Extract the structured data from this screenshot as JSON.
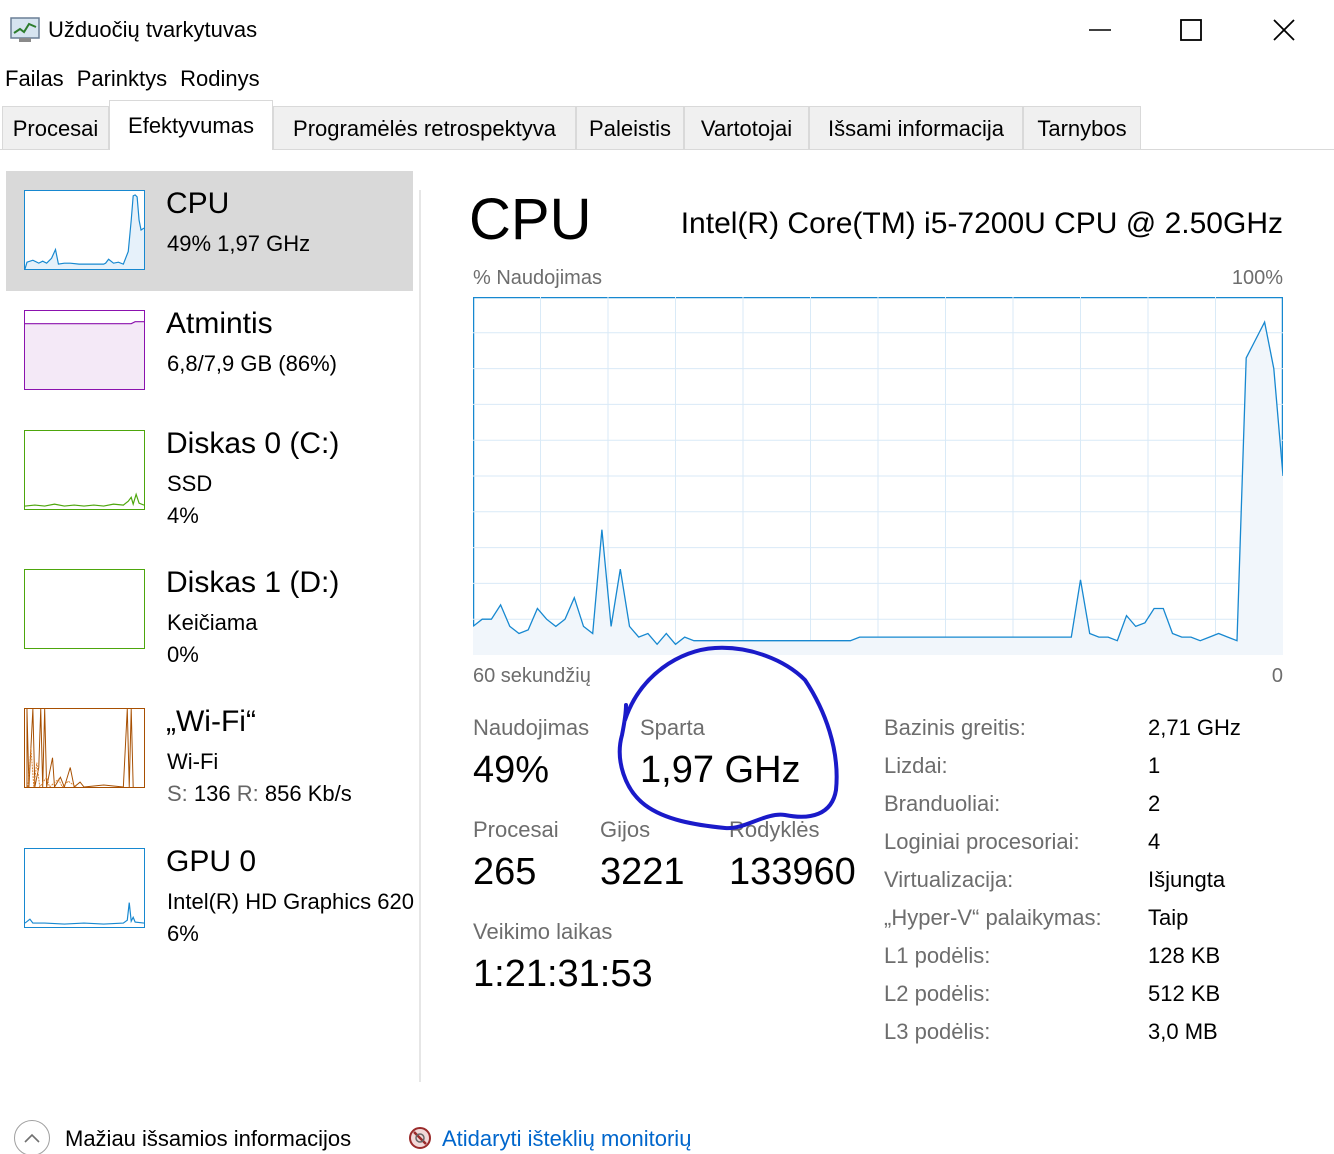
{
  "window": {
    "title": "Užduočių tvarkytuvas",
    "icon": "task-manager-icon"
  },
  "menu": [
    "Failas",
    "Parinktys",
    "Rodinys"
  ],
  "tabs": [
    {
      "label": "Procesai",
      "active": false
    },
    {
      "label": "Efektyvumas",
      "active": true
    },
    {
      "label": "Programėlės retrospektyva",
      "active": false
    },
    {
      "label": "Paleistis",
      "active": false
    },
    {
      "label": "Vartotojai",
      "active": false
    },
    {
      "label": "Išsami informacija",
      "active": false
    },
    {
      "label": "Tarnybos",
      "active": false
    }
  ],
  "devices": [
    {
      "name": "CPU",
      "line1": "49%  1,97 GHz",
      "line2": "",
      "color": "#1788d0"
    },
    {
      "name": "Atmintis",
      "line1": "6,8/7,9 GB (86%)",
      "line2": "",
      "color": "#8b12ae"
    },
    {
      "name": "Diskas 0 (C:)",
      "line1": "SSD",
      "line2": "4%",
      "color": "#4da60c"
    },
    {
      "name": "Diskas 1 (D:)",
      "line1": "Keičiama",
      "line2": "0%",
      "color": "#4da60c"
    },
    {
      "name": "„Wi-Fi“",
      "line1": "Wi-Fi",
      "line2_s": "S:",
      "line2_sv": "136",
      "line2_r": "R:",
      "line2_rv": "856 Kb/s",
      "color": "#a74f01"
    },
    {
      "name": "GPU 0",
      "line1": "Intel(R) HD Graphics 620",
      "line2": "6%",
      "color": "#1788d0"
    }
  ],
  "main": {
    "title": "CPU",
    "model": "Intel(R) Core(TM) i5-7200U CPU @ 2.50GHz",
    "graph_label_left": "% Naudojimas",
    "graph_label_right": "100%",
    "graph_bottom_left": "60 sekundžių",
    "graph_bottom_right": "0"
  },
  "stats": {
    "utilization_label": "Naudojimas",
    "utilization_value": "49%",
    "speed_label": "Sparta",
    "speed_value": "1,97 GHz",
    "processes_label": "Procesai",
    "processes_value": "265",
    "threads_label": "Gijos",
    "threads_value": "3221",
    "handles_label": "Rodyklės",
    "handles_value": "133960",
    "uptime_label": "Veikimo laikas",
    "uptime_value": "1:21:31:53"
  },
  "specs": [
    {
      "label": "Bazinis greitis:",
      "value": "2,71 GHz"
    },
    {
      "label": "Lizdai:",
      "value": "1"
    },
    {
      "label": "Branduoliai:",
      "value": "2"
    },
    {
      "label": "Loginiai procesoriai:",
      "value": "4"
    },
    {
      "label": "Virtualizacija:",
      "value": "Išjungta"
    },
    {
      "label": "„Hyper-V“ palaikymas:",
      "value": "Taip"
    },
    {
      "label": "L1 podėlis:",
      "value": "128 KB"
    },
    {
      "label": "L2 podėlis:",
      "value": "512 KB"
    },
    {
      "label": "L3 podėlis:",
      "value": "3,0 MB"
    }
  ],
  "footer": {
    "fewer_details": "Mažiau išsamios informacijos",
    "open_monitor": "Atidaryti išteklių monitorių"
  },
  "cpu_history": [
    8,
    10,
    10,
    14,
    8,
    6,
    7,
    13,
    10,
    8,
    10,
    16,
    8,
    6,
    35,
    8,
    24,
    8,
    5,
    6,
    3,
    6,
    3,
    5,
    4,
    4,
    4,
    4,
    4,
    4,
    4,
    4,
    4,
    4,
    4,
    4,
    4,
    4,
    4,
    4,
    4,
    4,
    5,
    5,
    5,
    5,
    5,
    5,
    5,
    5,
    5,
    5,
    5,
    5,
    5,
    5,
    5,
    5,
    5,
    5,
    5,
    5,
    5,
    5,
    5,
    5,
    21,
    6,
    5,
    5,
    4,
    11,
    8,
    9,
    13,
    13,
    6,
    5,
    5,
    4,
    5,
    6,
    5,
    4,
    83,
    88,
    93,
    80,
    50
  ]
}
